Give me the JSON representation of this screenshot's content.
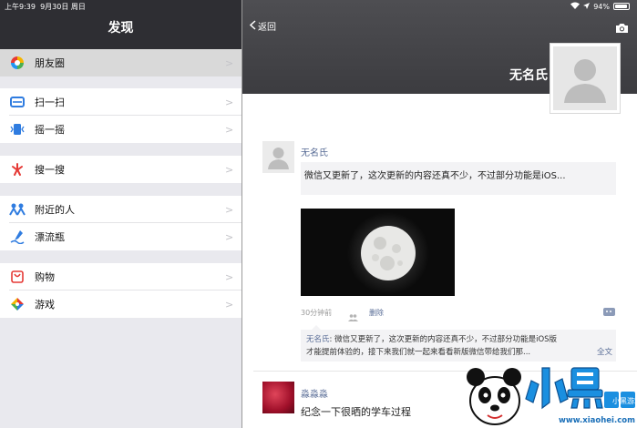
{
  "status_bar": {
    "time": "上午9:39",
    "date": "9月30日 周日",
    "battery": "94%",
    "battery_level": 0.94
  },
  "left": {
    "title": "发现",
    "items": [
      {
        "label": "朋友圈",
        "icon": "moments-icon"
      },
      {
        "label": "扫一扫",
        "icon": "scan-icon"
      },
      {
        "label": "摇一摇",
        "icon": "shake-icon"
      },
      {
        "label": "搜一搜",
        "icon": "search-icon"
      },
      {
        "label": "附近的人",
        "icon": "people-nearby-icon"
      },
      {
        "label": "漂流瓶",
        "icon": "drift-bottle-icon"
      },
      {
        "label": "购物",
        "icon": "shopping-icon"
      },
      {
        "label": "游戏",
        "icon": "games-icon"
      }
    ]
  },
  "right": {
    "back_label": "返回",
    "profile_name": "无名氏",
    "post1": {
      "author": "无名氏",
      "text": "微信又更新了，这次更新的内容还真不少，不过部分功能是iOS...",
      "time": "30分钟前",
      "delete_label": "删除",
      "comment": {
        "author": "无名氏",
        "line1": ": 微信又更新了，这次更新的内容还真不少，不过部分功能是iOS版",
        "line2": "才能提前体验的，接下来我们就一起来看看新版微信带给我们那...",
        "fulltext_label": "全文"
      }
    },
    "post2": {
      "author": "淼淼淼",
      "text": "纪念一下很晒的学车过程"
    }
  },
  "watermark": {
    "brand": "小黑游戏",
    "url": "www.xiaohei.com"
  }
}
